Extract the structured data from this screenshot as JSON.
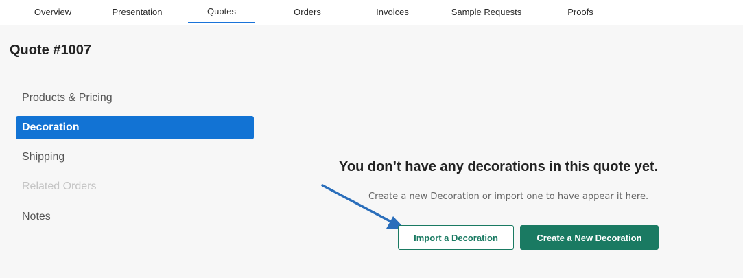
{
  "tabs": [
    {
      "label": "Overview",
      "active": false
    },
    {
      "label": "Presentation",
      "active": false
    },
    {
      "label": "Quotes",
      "active": true
    },
    {
      "label": "Orders",
      "active": false
    },
    {
      "label": "Invoices",
      "active": false
    },
    {
      "label": "Sample Requests",
      "active": false
    },
    {
      "label": "Proofs",
      "active": false
    }
  ],
  "page": {
    "title": "Quote #1007"
  },
  "sidebar": {
    "items": [
      {
        "label": "Products & Pricing",
        "state": "normal"
      },
      {
        "label": "Decoration",
        "state": "active"
      },
      {
        "label": "Shipping",
        "state": "normal"
      },
      {
        "label": "Related Orders",
        "state": "disabled"
      },
      {
        "label": "Notes",
        "state": "normal"
      }
    ]
  },
  "empty_state": {
    "title": "You don’t have any decorations in this quote yet.",
    "subtitle": "Create a new Decoration or import one to have appear it here.",
    "import_label": "Import a Decoration",
    "create_label": "Create a New Decoration"
  },
  "annotation": {
    "icon": "arrow-icon",
    "color": "#2a6ebb"
  },
  "colors": {
    "accent": "#1273d4",
    "brand_green": "#1a7a62"
  }
}
